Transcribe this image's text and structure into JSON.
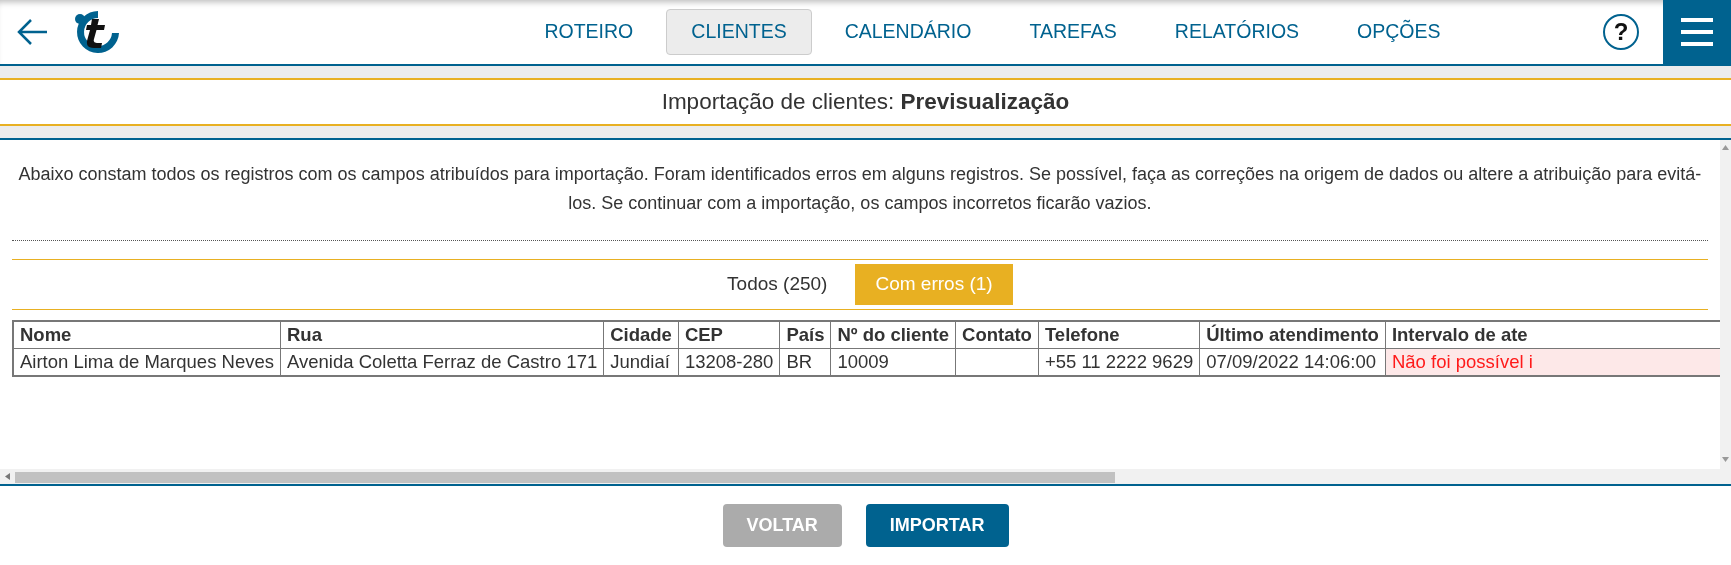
{
  "nav": {
    "tabs": [
      {
        "label": "ROTEIRO",
        "selected": false
      },
      {
        "label": "CLIENTES",
        "selected": true
      },
      {
        "label": "CALENDÁRIO",
        "selected": false
      },
      {
        "label": "TAREFAS",
        "selected": false
      },
      {
        "label": "RELATÓRIOS",
        "selected": false
      },
      {
        "label": "OPÇÕES",
        "selected": false
      }
    ],
    "help": "?"
  },
  "title": {
    "prefix": "Importação de clientes: ",
    "emphasis": "Previsualização"
  },
  "description": "Abaixo constam todos os registros com os campos atribuídos para importação. Foram identificados erros em alguns registros. Se possível, faça as correções na origem de dados ou altere a atribuição para evitá-los. Se continuar com a importação, os campos incorretos ficarão vazios.",
  "filters": [
    {
      "label": "Todos (250)",
      "selected": false
    },
    {
      "label": "Com erros (1)",
      "selected": true
    }
  ],
  "table": {
    "columns": [
      "Nome",
      "Rua",
      "Cidade",
      "CEP",
      "País",
      "Nº do cliente",
      "Contato",
      "Telefone",
      "Último atendimento",
      "Intervalo de ate"
    ],
    "rows": [
      {
        "cells": [
          {
            "text": "Airton Lima de Marques Neves",
            "error": false
          },
          {
            "text": "Avenida Coletta Ferraz de Castro 171",
            "error": false
          },
          {
            "text": "Jundiaí",
            "error": false
          },
          {
            "text": "13208-280",
            "error": false
          },
          {
            "text": "BR",
            "error": false
          },
          {
            "text": "10009",
            "error": false
          },
          {
            "text": "",
            "error": false
          },
          {
            "text": "+55 11 2222 9629",
            "error": false
          },
          {
            "text": "07/09/2022 14:06:00",
            "error": false
          },
          {
            "text": "Não foi possível i",
            "error": true
          }
        ]
      }
    ]
  },
  "buttons": [
    {
      "label": "VOLTAR",
      "disabled": true
    },
    {
      "label": "IMPORTAR",
      "disabled": false
    }
  ]
}
